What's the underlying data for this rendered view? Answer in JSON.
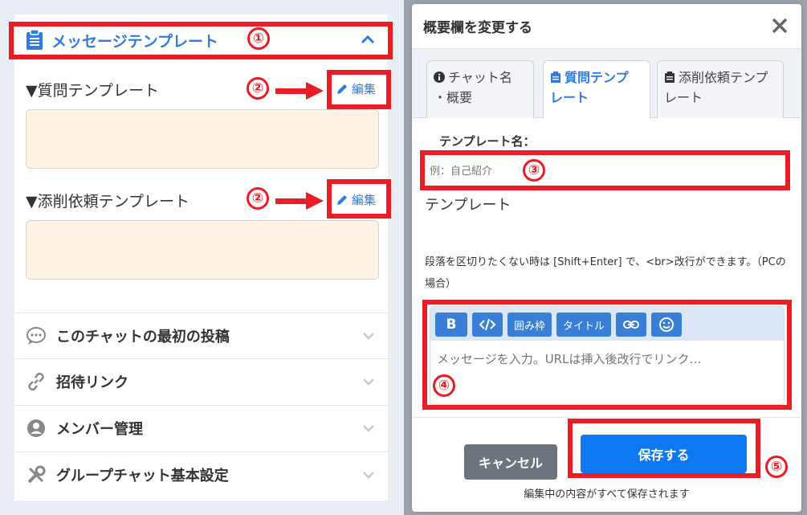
{
  "left": {
    "section_title": "メッセージテンプレート",
    "question_tpl_label": "▼質問テンプレート",
    "correction_tpl_label": "▼添削依頼テンプレート",
    "edit_label": "編集",
    "menu": [
      {
        "label": "このチャットの最初の投稿",
        "icon": "comment-dots-icon"
      },
      {
        "label": "招待リンク",
        "icon": "link-icon"
      },
      {
        "label": "メンバー管理",
        "icon": "user-circle-icon"
      },
      {
        "label": "グループチャット基本設定",
        "icon": "tools-icon"
      }
    ]
  },
  "annotations": {
    "n1": "①",
    "n2": "②",
    "n3": "③",
    "n4": "④",
    "n5": "⑤",
    "color": "#ec1c24"
  },
  "modal": {
    "title": "概要欄を変更する",
    "tabs": [
      {
        "label": "チャット名・概要",
        "line1": "チャット名",
        "line2": "・概要",
        "icon": "info-circle-icon"
      },
      {
        "label": "質問テンプレート",
        "line1": "質問テンプ",
        "line2": "レート",
        "icon": "clipboard-icon",
        "active": true
      },
      {
        "label": "添削依頼テンプレート",
        "line1": "添削依頼テンプ",
        "line2": "レート",
        "icon": "clipboard-icon"
      }
    ],
    "template_name_label": "テンプレート名：",
    "template_name_placeholder": "例：自己紹介",
    "template_heading": "テンプレート",
    "hint_text": "段落を区切りたくない時は [Shift+Enter] で、<br>改行ができます。（PCの場合）",
    "toolbar": {
      "bold": "B",
      "frame": "囲み枠",
      "title": "タイトル"
    },
    "message_placeholder": "メッセージを入力。URLは挿入後改行でリンク…",
    "cancel_label": "キャンセル",
    "save_label": "保存する",
    "footer_note": "編集中の内容がすべて保存されます"
  },
  "colors": {
    "accent": "#2f7be6",
    "save": "#0d78f2",
    "cancel": "#6c757d",
    "template_box": "#fdf2e3"
  }
}
